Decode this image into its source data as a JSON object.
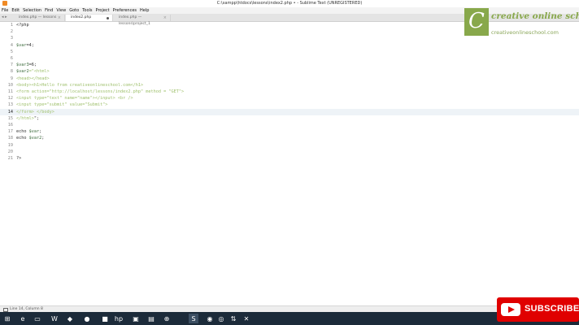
{
  "window": {
    "title": "C:\\xampp\\htdocs\\lessons\\index2.php • - Sublime Text (UNREGISTERED)"
  },
  "menu": [
    "File",
    "Edit",
    "Selection",
    "Find",
    "View",
    "Goto",
    "Tools",
    "Project",
    "Preferences",
    "Help"
  ],
  "tabs": [
    {
      "label": "index.php — lessons",
      "state": "close"
    },
    {
      "label": "index2.php",
      "state": "modified",
      "active": true
    },
    {
      "label": "index.php — lessons\\project_1",
      "state": "close"
    }
  ],
  "editor": {
    "current_line": 14,
    "lines": [
      {
        "n": "1",
        "segments": [
          {
            "t": "<?php",
            "c": "plain"
          }
        ]
      },
      {
        "n": "2",
        "segments": []
      },
      {
        "n": "3",
        "segments": []
      },
      {
        "n": "4",
        "segments": [
          {
            "t": "$var",
            "c": "var"
          },
          {
            "t": "=4;",
            "c": "plain"
          }
        ]
      },
      {
        "n": "5",
        "segments": []
      },
      {
        "n": "6",
        "segments": []
      },
      {
        "n": "7",
        "segments": [
          {
            "t": "$var3",
            "c": "var"
          },
          {
            "t": "=6;",
            "c": "plain"
          }
        ]
      },
      {
        "n": "8",
        "segments": [
          {
            "t": "$var2",
            "c": "var"
          },
          {
            "t": "=\"<html>",
            "c": "cmt"
          }
        ]
      },
      {
        "n": "9",
        "segments": [
          {
            "t": "<head></head>",
            "c": "cmt"
          }
        ]
      },
      {
        "n": "10",
        "segments": [
          {
            "t": "<body><h1>Hello from creativeonlineschool.com</h1>",
            "c": "cmt"
          }
        ]
      },
      {
        "n": "11",
        "segments": [
          {
            "t": "<form action=\"http://localhost/lessons/index2.php\" method = \"GET\">",
            "c": "cmt"
          }
        ]
      },
      {
        "n": "12",
        "segments": [
          {
            "t": "<input type=\"text\" name=\"name\"></input> <br />",
            "c": "cmt"
          }
        ]
      },
      {
        "n": "13",
        "segments": [
          {
            "t": "<input type=\"submit\" value=\"Submit\">",
            "c": "cmt"
          }
        ]
      },
      {
        "n": "14",
        "segments": [
          {
            "t": "</form> </body>",
            "c": "cmt"
          }
        ]
      },
      {
        "n": "15",
        "segments": [
          {
            "t": "</html>",
            "c": "cmt"
          },
          {
            "t": "\";",
            "c": "plain"
          }
        ]
      },
      {
        "n": "16",
        "segments": []
      },
      {
        "n": "17",
        "segments": [
          {
            "t": "echo ",
            "c": "plain"
          },
          {
            "t": "$var",
            "c": "var"
          },
          {
            "t": ";",
            "c": "plain"
          }
        ]
      },
      {
        "n": "18",
        "segments": [
          {
            "t": "echo ",
            "c": "plain"
          },
          {
            "t": "$var2",
            "c": "var"
          },
          {
            "t": ";",
            "c": "plain"
          }
        ]
      },
      {
        "n": "19",
        "segments": []
      },
      {
        "n": "20",
        "segments": []
      },
      {
        "n": "21",
        "segments": [
          {
            "t": "?>",
            "c": "plain"
          }
        ]
      }
    ]
  },
  "brand": {
    "logo_letter": "C",
    "name": "creative online school",
    "url": "creativeonlineschool.com"
  },
  "status": {
    "text": "Line 14, Column 8"
  },
  "taskbar": {
    "icons": [
      {
        "name": "windows-start-icon",
        "glyph": "⊞"
      },
      {
        "name": "edge-icon",
        "glyph": "e"
      },
      {
        "name": "folder-icon",
        "glyph": "▭"
      },
      {
        "name": "wow-icon",
        "glyph": "W"
      },
      {
        "name": "dropbox-icon",
        "glyph": "◆"
      },
      {
        "name": "chrome-icon",
        "glyph": "●"
      },
      {
        "name": "app-icon",
        "glyph": "■"
      },
      {
        "name": "hp-icon",
        "glyph": "hp"
      },
      {
        "name": "screen-icon",
        "glyph": "▣"
      },
      {
        "name": "photos-icon",
        "glyph": "▤"
      },
      {
        "name": "network-icon",
        "glyph": "⊕"
      },
      {
        "name": "sublime-icon",
        "glyph": "S"
      },
      {
        "name": "firefox-icon",
        "glyph": "◉"
      },
      {
        "name": "camera-icon",
        "glyph": "◎"
      },
      {
        "name": "fileshare-icon",
        "glyph": "⇅"
      },
      {
        "name": "xampp-icon",
        "glyph": "✕"
      }
    ]
  },
  "subscribe": {
    "label": "SUBSCRIBE"
  },
  "colors": {
    "brand_green": "#88a84b",
    "subscribe_red": "#e00000",
    "taskbar": "#1c2b3a"
  }
}
